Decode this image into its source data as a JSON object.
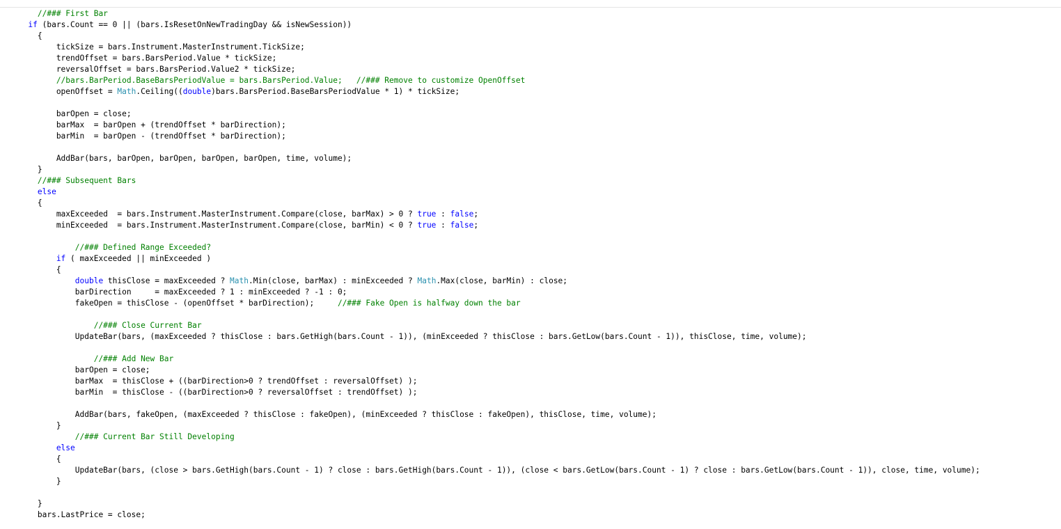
{
  "code": {
    "lines": [
      [
        [
          "c",
          "        //### First Bar"
        ]
      ],
      [
        [
          "k",
          "      if"
        ],
        [
          "p",
          " (bars.Count == 0 || (bars.IsResetOnNewTradingDay && isNewSession))"
        ]
      ],
      [
        [
          "p",
          "        {"
        ]
      ],
      [
        [
          "p",
          "            tickSize = bars.Instrument.MasterInstrument.TickSize;"
        ]
      ],
      [
        [
          "p",
          "            trendOffset = bars.BarsPeriod.Value * tickSize;"
        ]
      ],
      [
        [
          "p",
          "            reversalOffset = bars.BarsPeriod.Value2 * tickSize;"
        ]
      ],
      [
        [
          "c",
          "            //bars.BarPeriod.BaseBarsPeriodValue = bars.BarsPeriod.Value;   //### Remove to customize OpenOffset"
        ]
      ],
      [
        [
          "p",
          "            openOffset = "
        ],
        [
          "t",
          "Math"
        ],
        [
          "p",
          ".Ceiling(("
        ],
        [
          "k",
          "double"
        ],
        [
          "p",
          ")bars.BarsPeriod.BaseBarsPeriodValue * 1) * tickSize;"
        ]
      ],
      [
        [
          "p",
          ""
        ]
      ],
      [
        [
          "p",
          "            barOpen = close;"
        ]
      ],
      [
        [
          "p",
          "            barMax  = barOpen + (trendOffset * barDirection);"
        ]
      ],
      [
        [
          "p",
          "            barMin  = barOpen - (trendOffset * barDirection);"
        ]
      ],
      [
        [
          "p",
          ""
        ]
      ],
      [
        [
          "p",
          "            AddBar(bars, barOpen, barOpen, barOpen, barOpen, time, volume);"
        ]
      ],
      [
        [
          "p",
          "        }"
        ]
      ],
      [
        [
          "c",
          "        //### Subsequent Bars"
        ]
      ],
      [
        [
          "k",
          "        else"
        ]
      ],
      [
        [
          "p",
          "        {"
        ]
      ],
      [
        [
          "p",
          "            maxExceeded  = bars.Instrument.MasterInstrument.Compare(close, barMax) > 0 ? "
        ],
        [
          "k",
          "true"
        ],
        [
          "p",
          " : "
        ],
        [
          "k",
          "false"
        ],
        [
          "p",
          ";"
        ]
      ],
      [
        [
          "p",
          "            minExceeded  = bars.Instrument.MasterInstrument.Compare(close, barMin) < 0 ? "
        ],
        [
          "k",
          "true"
        ],
        [
          "p",
          " : "
        ],
        [
          "k",
          "false"
        ],
        [
          "p",
          ";"
        ]
      ],
      [
        [
          "p",
          ""
        ]
      ],
      [
        [
          "c",
          "                //### Defined Range Exceeded?"
        ]
      ],
      [
        [
          "k",
          "            if"
        ],
        [
          "p",
          " ( maxExceeded || minExceeded )"
        ]
      ],
      [
        [
          "p",
          "            {"
        ]
      ],
      [
        [
          "k",
          "                double"
        ],
        [
          "p",
          " thisClose = maxExceeded ? "
        ],
        [
          "t",
          "Math"
        ],
        [
          "p",
          ".Min(close, barMax) : minExceeded ? "
        ],
        [
          "t",
          "Math"
        ],
        [
          "p",
          ".Max(close, barMin) : close;"
        ]
      ],
      [
        [
          "p",
          "                barDirection     = maxExceeded ? 1 : minExceeded ? -1 : 0;"
        ]
      ],
      [
        [
          "p",
          "                fakeOpen = thisClose - (openOffset * barDirection);     "
        ],
        [
          "c",
          "//### Fake Open is halfway down the bar"
        ]
      ],
      [
        [
          "p",
          ""
        ]
      ],
      [
        [
          "c",
          "                    //### Close Current Bar"
        ]
      ],
      [
        [
          "p",
          "                UpdateBar(bars, (maxExceeded ? thisClose : bars.GetHigh(bars.Count - 1)), (minExceeded ? thisClose : bars.GetLow(bars.Count - 1)), thisClose, time, volume);"
        ]
      ],
      [
        [
          "p",
          ""
        ]
      ],
      [
        [
          "c",
          "                    //### Add New Bar"
        ]
      ],
      [
        [
          "p",
          "                barOpen = close;"
        ]
      ],
      [
        [
          "p",
          "                barMax  = thisClose + ((barDirection>0 ? trendOffset : reversalOffset) );"
        ]
      ],
      [
        [
          "p",
          "                barMin  = thisClose - ((barDirection>0 ? reversalOffset : trendOffset) );"
        ]
      ],
      [
        [
          "p",
          ""
        ]
      ],
      [
        [
          "p",
          "                AddBar(bars, fakeOpen, (maxExceeded ? thisClose : fakeOpen), (minExceeded ? thisClose : fakeOpen), thisClose, time, volume);"
        ]
      ],
      [
        [
          "p",
          "            }"
        ]
      ],
      [
        [
          "c",
          "                //### Current Bar Still Developing"
        ]
      ],
      [
        [
          "k",
          "            else"
        ]
      ],
      [
        [
          "p",
          "            {"
        ]
      ],
      [
        [
          "p",
          "                UpdateBar(bars, (close > bars.GetHigh(bars.Count - 1) ? close : bars.GetHigh(bars.Count - 1)), (close < bars.GetLow(bars.Count - 1) ? close : bars.GetLow(bars.Count - 1)), close, time, volume);"
        ]
      ],
      [
        [
          "p",
          "            }"
        ]
      ],
      [
        [
          "p",
          ""
        ]
      ],
      [
        [
          "p",
          "        }"
        ]
      ],
      [
        [
          "p",
          "        bars.LastPrice = close;"
        ]
      ]
    ]
  }
}
